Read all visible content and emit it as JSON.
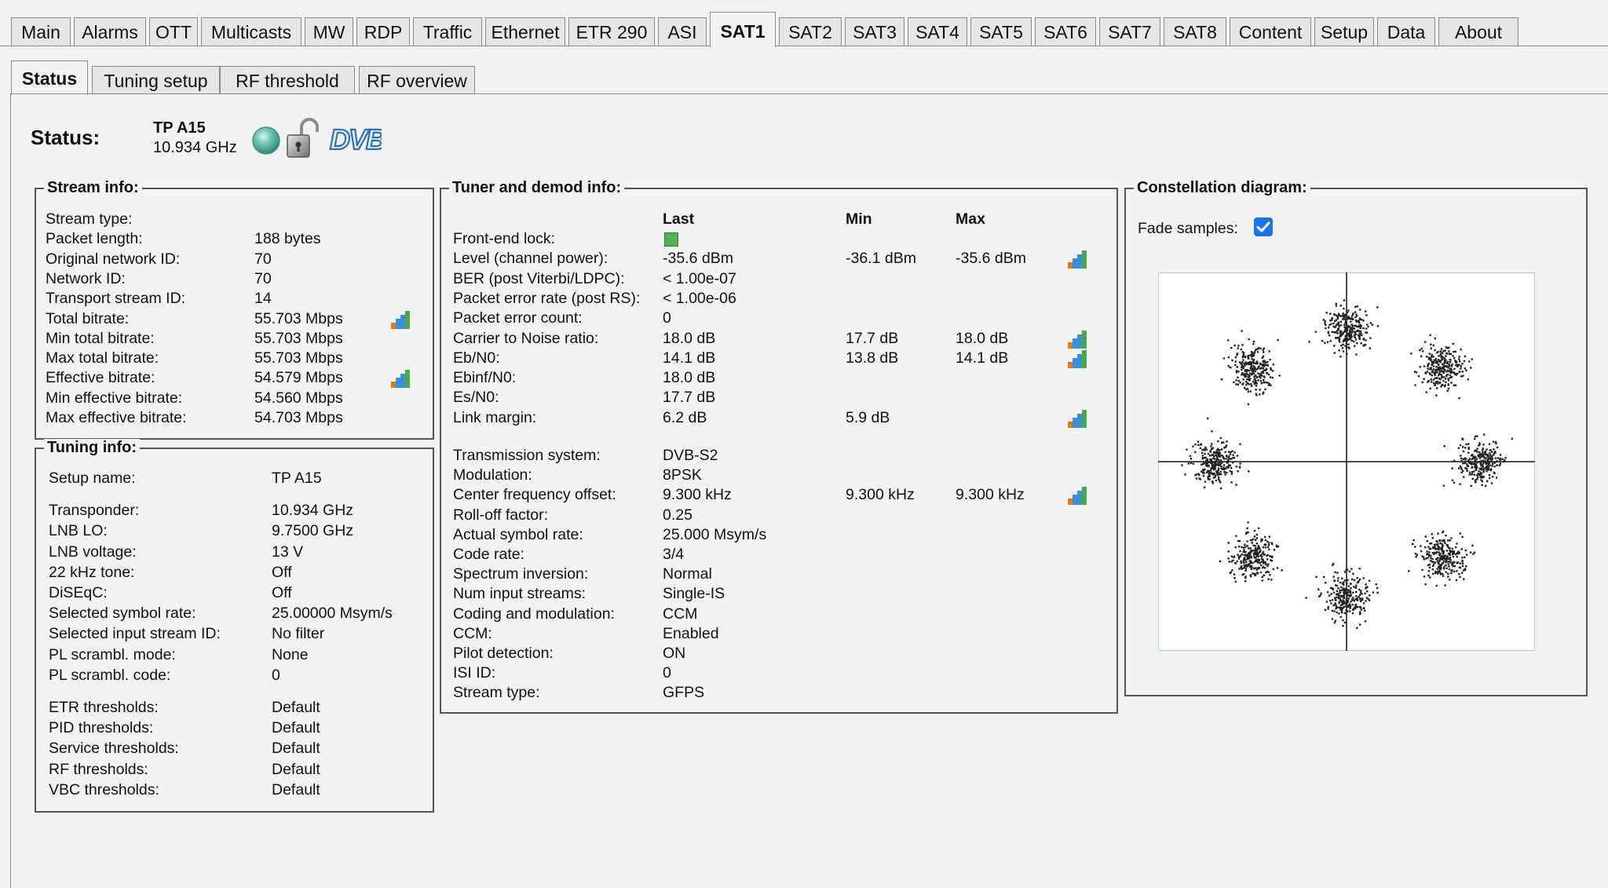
{
  "top_tabs": [
    "Main",
    "Alarms",
    "OTT",
    "Multicasts",
    "MW",
    "RDP",
    "Traffic",
    "Ethernet",
    "ETR 290",
    "ASI",
    "SAT1",
    "SAT2",
    "SAT3",
    "SAT4",
    "SAT5",
    "SAT6",
    "SAT7",
    "SAT8",
    "Content",
    "Setup",
    "Data",
    "About"
  ],
  "active_top_tab": "SAT1",
  "sub_tabs": [
    "Status",
    "Tuning setup",
    "RF threshold",
    "RF overview"
  ],
  "active_sub_tab": "Status",
  "status": {
    "label": "Status:",
    "tp_name": "TP A15",
    "frequency": "10.934 GHz",
    "logo_text": "DVB"
  },
  "stream_info": {
    "title": "Stream info:",
    "rows": [
      {
        "label": "Stream type:",
        "value": "",
        "chart": false
      },
      {
        "label": "Packet length:",
        "value": "188 bytes",
        "chart": false
      },
      {
        "label": "Original network ID:",
        "value": "70",
        "chart": false
      },
      {
        "label": "Network ID:",
        "value": "70",
        "chart": false
      },
      {
        "label": "Transport stream ID:",
        "value": "14",
        "chart": false
      },
      {
        "label": "Total bitrate:",
        "value": "55.703 Mbps",
        "chart": true
      },
      {
        "label": "Min total bitrate:",
        "value": "55.703 Mbps",
        "chart": false
      },
      {
        "label": "Max total bitrate:",
        "value": "55.703 Mbps",
        "chart": false
      },
      {
        "label": "Effective bitrate:",
        "value": "54.579 Mbps",
        "chart": true
      },
      {
        "label": "Min effective bitrate:",
        "value": "54.560 Mbps",
        "chart": false
      },
      {
        "label": "Max effective bitrate:",
        "value": "54.703 Mbps",
        "chart": false
      }
    ]
  },
  "tuning_info": {
    "title": "Tuning info:",
    "groups": [
      [
        {
          "label": "Setup name:",
          "value": "TP A15"
        }
      ],
      [
        {
          "label": "Transponder:",
          "value": "10.934 GHz"
        },
        {
          "label": "LNB LO:",
          "value": "9.7500 GHz"
        },
        {
          "label": "LNB voltage:",
          "value": "13 V"
        },
        {
          "label": "22 kHz tone:",
          "value": "Off"
        },
        {
          "label": "DiSEqC:",
          "value": "Off"
        },
        {
          "label": "Selected symbol rate:",
          "value": "25.00000 Msym/s"
        },
        {
          "label": "Selected input stream ID:",
          "value": "No filter"
        },
        {
          "label": "PL scrambl. mode:",
          "value": "None"
        },
        {
          "label": "PL scrambl. code:",
          "value": "0"
        }
      ],
      [
        {
          "label": "ETR thresholds:",
          "value": "Default"
        },
        {
          "label": "PID thresholds:",
          "value": "Default"
        },
        {
          "label": "Service thresholds:",
          "value": "Default"
        },
        {
          "label": "RF thresholds:",
          "value": "Default"
        },
        {
          "label": "VBC thresholds:",
          "value": "Default"
        }
      ]
    ]
  },
  "tuner_info": {
    "title": "Tuner and demod info:",
    "col_last": "Last",
    "col_min": "Min",
    "col_max": "Max",
    "rows_top": [
      {
        "label": "Front-end lock:",
        "last": "",
        "min": "",
        "max": "",
        "chart": false,
        "lock": true
      },
      {
        "label": "Level (channel power):",
        "last": "-35.6 dBm",
        "min": "-36.1 dBm",
        "max": "-35.6 dBm",
        "chart": true
      },
      {
        "label": "BER (post Viterbi/LDPC):",
        "last": "< 1.00e-07",
        "min": "",
        "max": "",
        "chart": false
      },
      {
        "label": "Packet error rate (post RS):",
        "last": "< 1.00e-06",
        "min": "",
        "max": "",
        "chart": false
      },
      {
        "label": "Packet error count:",
        "last": "0",
        "min": "",
        "max": "",
        "chart": false
      },
      {
        "label": "Carrier to Noise ratio:",
        "last": "18.0 dB",
        "min": "17.7 dB",
        "max": "18.0 dB",
        "chart": true
      },
      {
        "label": "Eb/N0:",
        "last": "14.1 dB",
        "min": "13.8 dB",
        "max": "14.1 dB",
        "chart": true
      },
      {
        "label": "Ebinf/N0:",
        "last": "18.0 dB",
        "min": "",
        "max": "",
        "chart": false
      },
      {
        "label": "Es/N0:",
        "last": "17.7 dB",
        "min": "",
        "max": "",
        "chart": false
      },
      {
        "label": "Link margin:",
        "last": "6.2 dB",
        "min": "5.9 dB",
        "max": "",
        "chart": true
      }
    ],
    "rows_bottom": [
      {
        "label": "Transmission system:",
        "last": "DVB-S2",
        "min": "",
        "max": "",
        "chart": false
      },
      {
        "label": "Modulation:",
        "last": "8PSK",
        "min": "",
        "max": "",
        "chart": false
      },
      {
        "label": "Center frequency offset:",
        "last": "9.300 kHz",
        "min": "9.300 kHz",
        "max": "9.300 kHz",
        "chart": true
      },
      {
        "label": "Roll-off factor:",
        "last": "0.25",
        "min": "",
        "max": "",
        "chart": false
      },
      {
        "label": "Actual symbol rate:",
        "last": "25.000 Msym/s",
        "min": "",
        "max": "",
        "chart": false
      },
      {
        "label": "Code rate:",
        "last": "3/4",
        "min": "",
        "max": "",
        "chart": false
      },
      {
        "label": "Spectrum inversion:",
        "last": "Normal",
        "min": "",
        "max": "",
        "chart": false
      },
      {
        "label": "Num input streams:",
        "last": "Single-IS",
        "min": "",
        "max": "",
        "chart": false
      },
      {
        "label": "Coding and modulation:",
        "last": "CCM",
        "min": "",
        "max": "",
        "chart": false
      },
      {
        "label": "CCM:",
        "last": "Enabled",
        "min": "",
        "max": "",
        "chart": false
      },
      {
        "label": "Pilot detection:",
        "last": "ON",
        "min": "",
        "max": "",
        "chart": false
      },
      {
        "label": "ISI ID:",
        "last": "0",
        "min": "",
        "max": "",
        "chart": false
      },
      {
        "label": "Stream type:",
        "last": "GFPS",
        "min": "",
        "max": "",
        "chart": false
      }
    ]
  },
  "constellation": {
    "title": "Constellation diagram:",
    "fade_label": "Fade samples:",
    "fade_checked": true,
    "modulation_points": 8
  },
  "colors": {
    "lock_green": "#52b152",
    "checkbox_blue": "#1a73e8",
    "dvb_blue": "#2a6fbf"
  }
}
